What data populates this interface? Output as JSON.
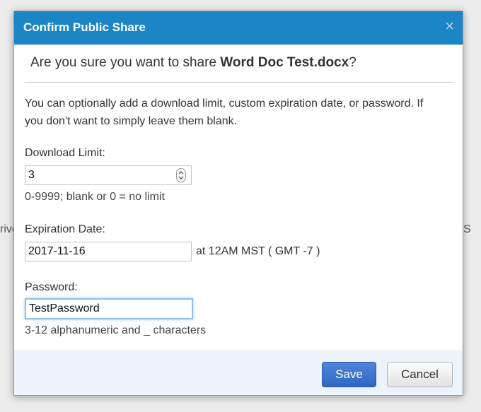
{
  "background": {
    "left_fragment": "rive",
    "right_fragment": "S"
  },
  "dialog": {
    "title": "Confirm Public Share",
    "close_symbol": "×",
    "question": {
      "prefix": "Are you sure you want to share ",
      "filename": "Word Doc Test.docx",
      "suffix": "?"
    },
    "intro": "You can optionally add a download limit, custom expiration date, or password. If you don't want to simply leave them blank.",
    "download_limit": {
      "label": "Download Limit:",
      "value": "3",
      "hint": "0-9999; blank or 0 = no limit"
    },
    "expiration": {
      "label": "Expiration Date:",
      "value": "2017-11-16",
      "timezone": "at 12AM MST ( GMT -7 )"
    },
    "password": {
      "label": "Password:",
      "value": "TestPassword",
      "hint": "3-12 alphanumeric and _ characters"
    },
    "buttons": {
      "save": "Save",
      "cancel": "Cancel"
    }
  },
  "colors": {
    "header": "#1b85c6",
    "save_button": "#3a72cc",
    "footer": "#edf3fa"
  },
  "icons": {
    "close": "close-icon",
    "spinner": "spinner-arrows-icon"
  }
}
